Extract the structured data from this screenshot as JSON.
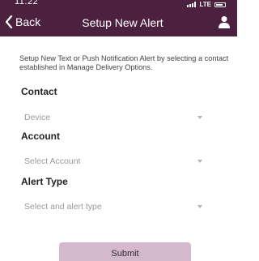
{
  "status_bar": {
    "time": "11:22",
    "network": "LTE"
  },
  "header": {
    "back_label": "Back",
    "title": "Setup New Alert",
    "background": "#4c2140"
  },
  "description": "Setup New Text or Push Notification Alert by selecting a contact established in Manage Delivery Options.",
  "form": {
    "contact": {
      "label": "Contact",
      "value": "Device"
    },
    "account": {
      "label": "Account",
      "placeholder": "Select Account"
    },
    "alert_type": {
      "label": "Alert Type",
      "placeholder": "Select and alert type"
    }
  },
  "submit_label": "Submit",
  "submit_color": "#d4b8cb"
}
